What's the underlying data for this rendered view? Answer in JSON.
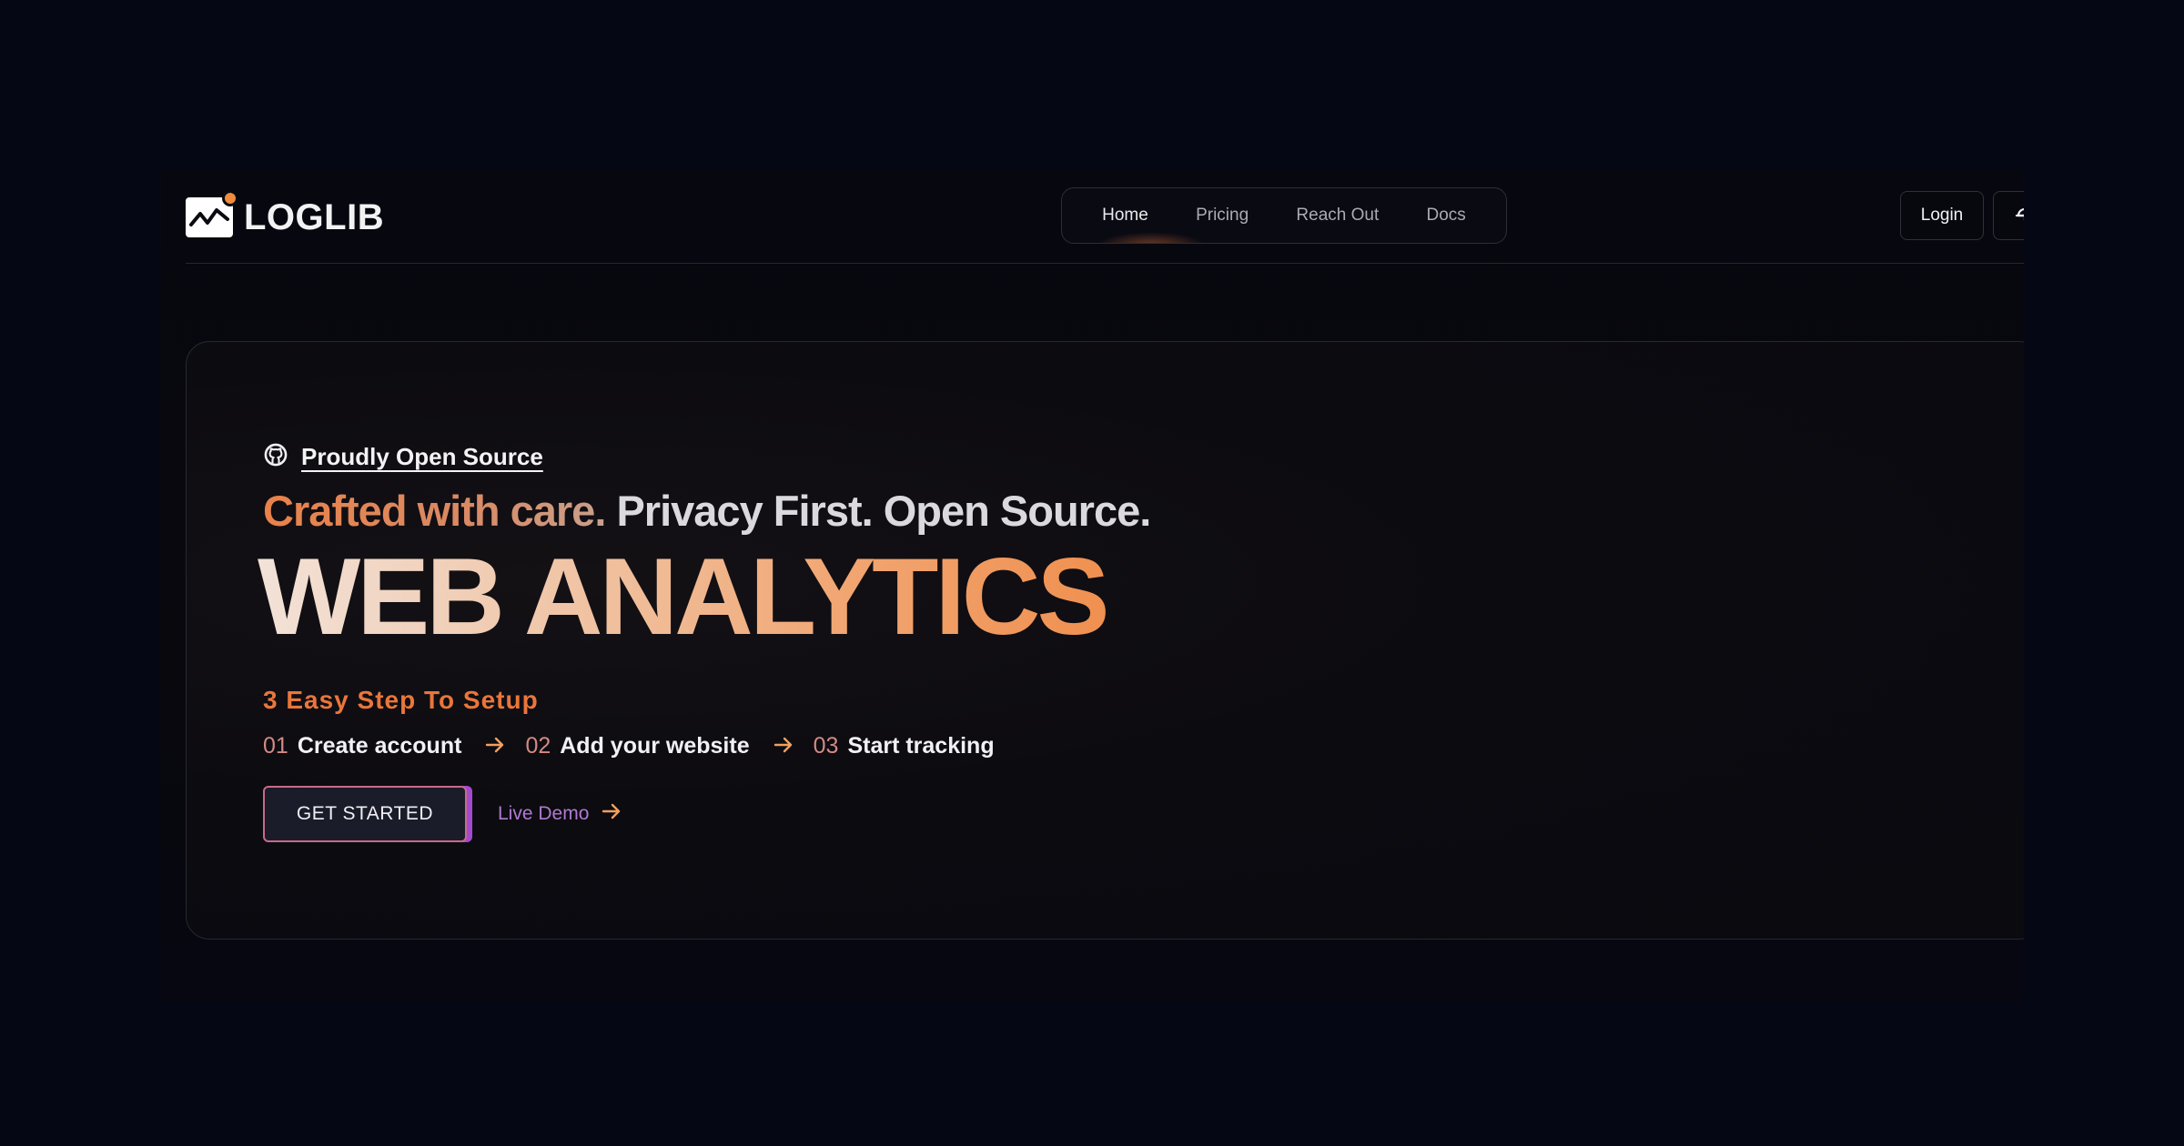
{
  "header": {
    "logo_text": "LOGLIB",
    "nav": [
      {
        "label": "Home",
        "active": true
      },
      {
        "label": "Pricing",
        "active": false
      },
      {
        "label": "Reach Out",
        "active": false
      },
      {
        "label": "Docs",
        "active": false
      }
    ],
    "login_label": "Login",
    "theme_icon": "cloud-icon"
  },
  "hero": {
    "open_source_label": "Proudly Open Source",
    "open_source_icon": "github-icon",
    "tagline_accent": "Crafted with care.",
    "tagline_rest": " Privacy First. Open Source.",
    "headline": "WEB ANALYTICS",
    "steps_title": "3 Easy Step To Setup",
    "steps": [
      {
        "num": "01",
        "label": "Create account"
      },
      {
        "num": "02",
        "label": "Add your website"
      },
      {
        "num": "03",
        "label": "Start tracking"
      }
    ],
    "cta_primary": "GET STARTED",
    "cta_secondary": "Live Demo"
  },
  "colors": {
    "background": "#050814",
    "accent_orange": "#e9763b",
    "accent_purple": "#a24acf",
    "link_purple": "#b07ad0"
  }
}
